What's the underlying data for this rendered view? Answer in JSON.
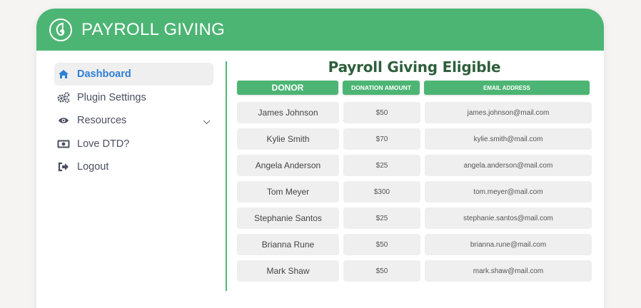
{
  "app": {
    "title": "PAYROLL GIVING",
    "accent": "#4db574",
    "title_color": "#2e5f3c",
    "link_color": "#2f7fd6"
  },
  "sidebar": {
    "items": [
      {
        "label": "Dashboard",
        "icon": "home-icon",
        "active": true
      },
      {
        "label": "Plugin Settings",
        "icon": "gears-icon",
        "active": false
      },
      {
        "label": "Resources",
        "icon": "eye-icon",
        "active": false,
        "has_submenu": true
      },
      {
        "label": "Love DTD?",
        "icon": "money-icon",
        "active": false
      },
      {
        "label": "Logout",
        "icon": "logout-icon",
        "active": false
      }
    ]
  },
  "main": {
    "title": "Payroll Giving Eligible",
    "columns": [
      "DONOR",
      "DONATION AMOUNT",
      "EMAIL ADDRESS"
    ],
    "rows": [
      {
        "donor": "James Johnson",
        "amount": "$50",
        "email": "james.johnson@mail.com"
      },
      {
        "donor": "Kylie Smith",
        "amount": "$70",
        "email": "kylie.smith@mail.com"
      },
      {
        "donor": "Angela Anderson",
        "amount": "$25",
        "email": "angela.anderson@mail.com"
      },
      {
        "donor": "Tom Meyer",
        "amount": "$300",
        "email": "tom.meyer@mail.com"
      },
      {
        "donor": "Stephanie Santos",
        "amount": "$25",
        "email": "stephanie.santos@mail.com"
      },
      {
        "donor": "Brianna Rune",
        "amount": "$50",
        "email": "brianna.rune@mail.com"
      },
      {
        "donor": "Mark Shaw",
        "amount": "$50",
        "email": "mark.shaw@mail.com"
      }
    ]
  }
}
